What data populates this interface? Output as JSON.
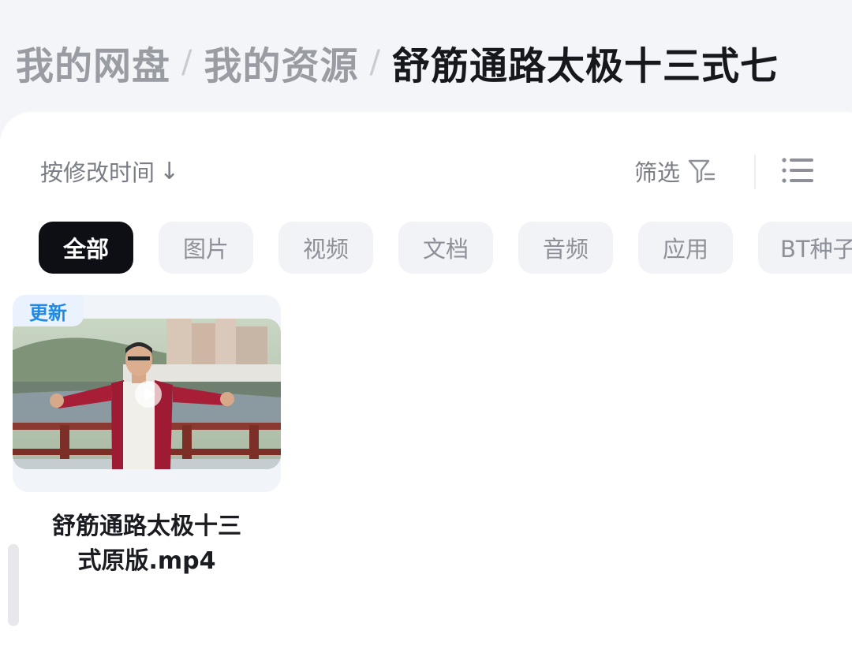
{
  "breadcrumb": {
    "items": [
      "我的网盘",
      "我的资源",
      "舒筋通路太极十三式七"
    ],
    "separator": "/"
  },
  "toolbar": {
    "sort_label": "按修改时间",
    "sort_direction": "↓",
    "filter_label": "筛选"
  },
  "categories": [
    "全部",
    "图片",
    "视频",
    "文档",
    "音频",
    "应用",
    "BT种子"
  ],
  "file": {
    "badge": "更新",
    "name_line1": "舒筋通路太极十三",
    "name_line2": "式原版.mp4"
  },
  "colors": {
    "active_chip": "#0d0f14",
    "badge_text": "#1e8ae6",
    "badge_bg": "#e9f2fd"
  },
  "icons": [
    "filter-icon",
    "list-view-icon",
    "play-icon"
  ]
}
